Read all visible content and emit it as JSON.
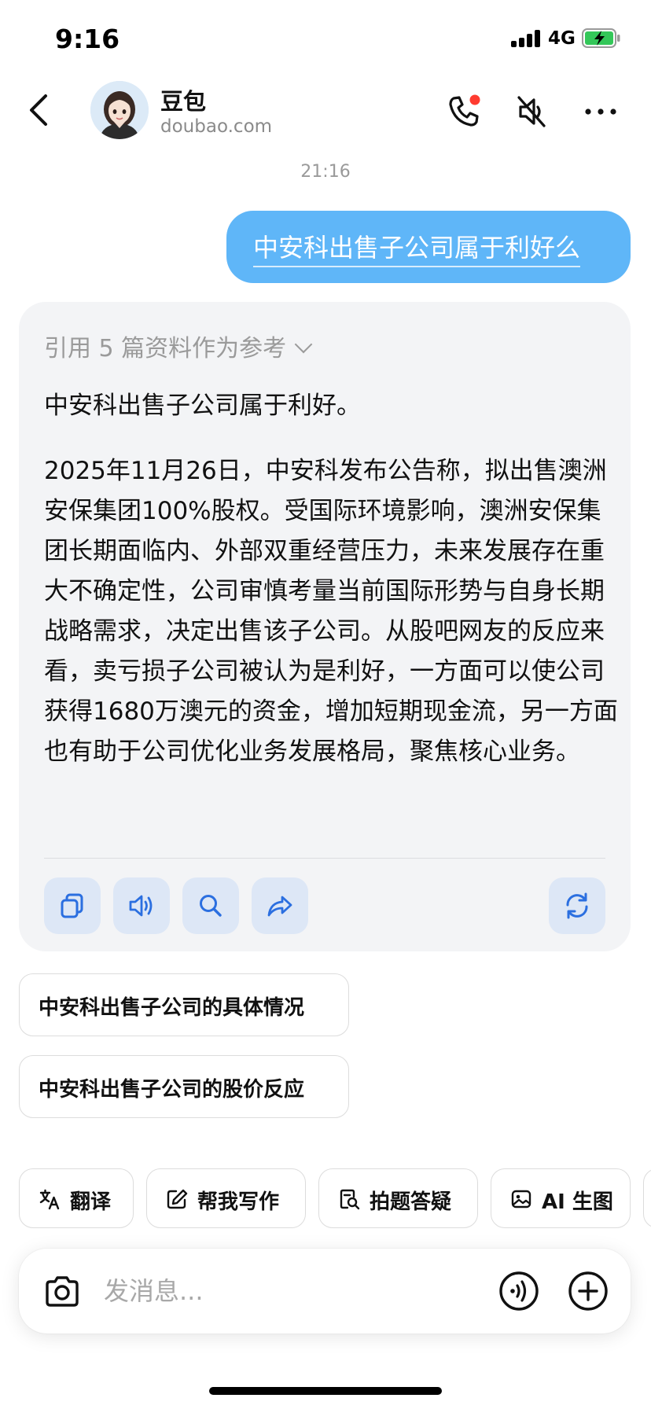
{
  "status_bar": {
    "time": "9:16",
    "network": "4G",
    "icons": [
      "signal-icon",
      "battery-charging-icon"
    ]
  },
  "header": {
    "name": "豆包",
    "domain": "doubao.com",
    "icons": [
      "back-icon",
      "avatar",
      "phone-call-icon",
      "speaker-muted-icon",
      "more-icon"
    ]
  },
  "chat": {
    "timestamp": "21:16",
    "user_message": "中安科出售子公司属于利好么",
    "answer": {
      "references_label": "引用 5 篇资料作为参考",
      "lead": "中安科出售子公司属于利好。",
      "body": "2025年11月26日，中安科发布公告称，拟出售澳洲安保集团100%股权。受国际环境影响，澳洲安保集团长期面临内、外部双重经营压力，未来发展存在重大不确定性，公司审慎考量当前国际形势与自身长期战略需求，决定出售该子公司。从股吧网友的反应来看，卖亏损子公司被认为是利好，一方面可以使公司获得1680万澳元的资金，增加短期现金流，另一方面也有助于公司优化业务发展格局，聚焦核心业务。",
      "action_icons": [
        "copy-icon",
        "speaker-icon",
        "search-icon",
        "share-icon",
        "regenerate-icon"
      ]
    },
    "suggestions": [
      "中安科出售子公司的具体情况",
      "中安科出售子公司的股价反应"
    ]
  },
  "tools": [
    {
      "label": "翻译",
      "icon": "translate-icon"
    },
    {
      "label": "帮我写作",
      "icon": "edit-icon"
    },
    {
      "label": "拍题答疑",
      "icon": "document-search-icon"
    },
    {
      "label": "AI 生图",
      "icon": "image-icon"
    }
  ],
  "input": {
    "placeholder": "发消息...",
    "icons": [
      "camera-icon",
      "voice-call-icon",
      "plus-icon"
    ]
  },
  "colors": {
    "user_bubble": "#5fb6f8",
    "answer_card": "#f3f4f6",
    "action_button": "#dde7f6",
    "action_icon": "#2b6fe0",
    "battery_green": "#34c759",
    "notify_red": "#ff3b30"
  }
}
